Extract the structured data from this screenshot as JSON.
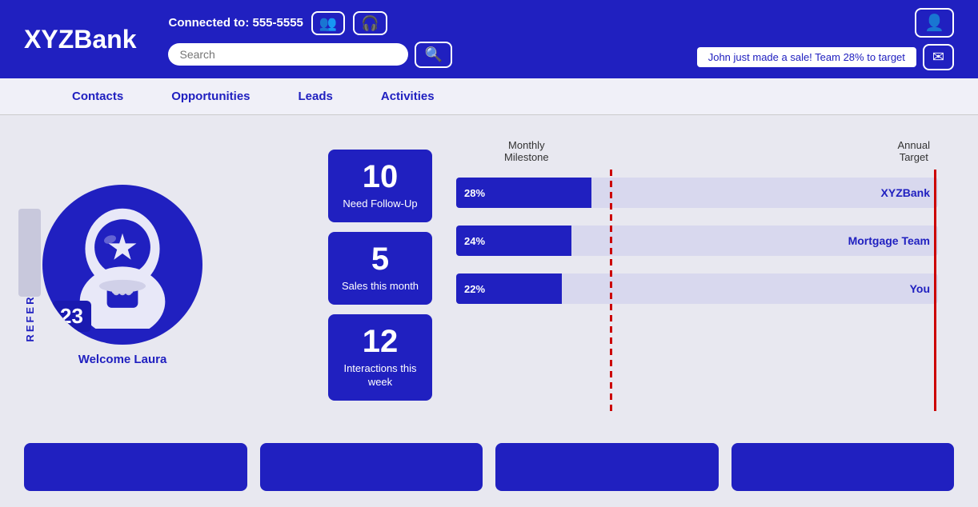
{
  "header": {
    "logo": "XYZBank",
    "connected_label": "Connected to:",
    "phone": "555-5555",
    "search_placeholder": "Search",
    "notification": "John just made  a sale! Team 28% to target",
    "group_icon": "👥",
    "headset_icon": "🎧",
    "profile_icon": "👤",
    "mail_icon": "✉",
    "search_icon": "🔍"
  },
  "nav": {
    "items": [
      {
        "label": "Contacts"
      },
      {
        "label": "Opportunities"
      },
      {
        "label": "Leads"
      },
      {
        "label": "Activities"
      }
    ]
  },
  "referral": {
    "label": "REFERRAL POINTS"
  },
  "avatar": {
    "welcome": "Welcome Laura",
    "points": "23"
  },
  "stats": [
    {
      "number": "10",
      "label": "Need Follow-Up"
    },
    {
      "number": "5",
      "label": "Sales this month"
    },
    {
      "number": "12",
      "label": "Interactions this week"
    }
  ],
  "chart": {
    "monthly_label": "Monthly\nMilestone",
    "annual_label": "Annual\nTarget",
    "bars": [
      {
        "label": "XYZBank",
        "pct": 28,
        "pct_text": "28%"
      },
      {
        "label": "Mortgage Team",
        "pct": 24,
        "pct_text": "24%"
      },
      {
        "label": "You",
        "pct": 22,
        "pct_text": "22%"
      }
    ],
    "monthly_milestone_pct": 32,
    "annual_target_pct": 100
  }
}
